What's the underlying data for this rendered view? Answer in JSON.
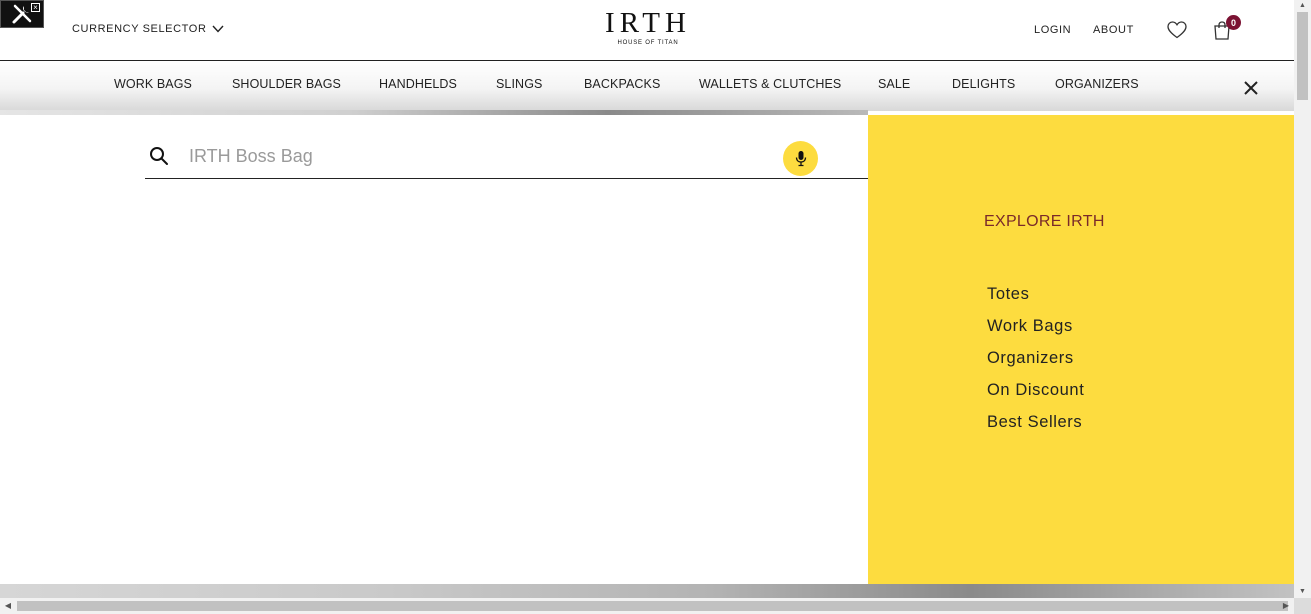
{
  "header": {
    "currency_label": "CURRENCY SELECTOR",
    "logo_text": "IRTH",
    "logo_sub": "HOUSE OF TITAN",
    "login_label": "LOGIN",
    "about_label": "ABOUT",
    "cart_count": "0"
  },
  "nav": {
    "items": [
      {
        "label": "WORK BAGS"
      },
      {
        "label": "SHOULDER BAGS"
      },
      {
        "label": "HANDHELDS"
      },
      {
        "label": "SLINGS"
      },
      {
        "label": "BACKPACKS"
      },
      {
        "label": "WALLETS & CLUTCHES"
      },
      {
        "label": "SALE"
      },
      {
        "label": "DELIGHTS"
      },
      {
        "label": "ORGANIZERS"
      }
    ]
  },
  "search": {
    "placeholder": "IRTH Boss Bag",
    "value": ""
  },
  "explore": {
    "title": "EXPLORE IRTH",
    "links": [
      {
        "label": "Totes"
      },
      {
        "label": "Work Bags"
      },
      {
        "label": "Organizers"
      },
      {
        "label": "On Discount"
      },
      {
        "label": "Best Sellers"
      }
    ]
  },
  "colors": {
    "accent_yellow": "#fddc3f",
    "cart_badge": "#7b1233",
    "explore_title": "#7a2a2a"
  },
  "icons": {
    "devtools": "tools-icon",
    "currency_chevron": "chevron-down-icon",
    "wishlist": "heart-icon",
    "cart": "shopping-bag-icon",
    "close": "close-icon",
    "search": "search-icon",
    "mic": "microphone-icon"
  }
}
